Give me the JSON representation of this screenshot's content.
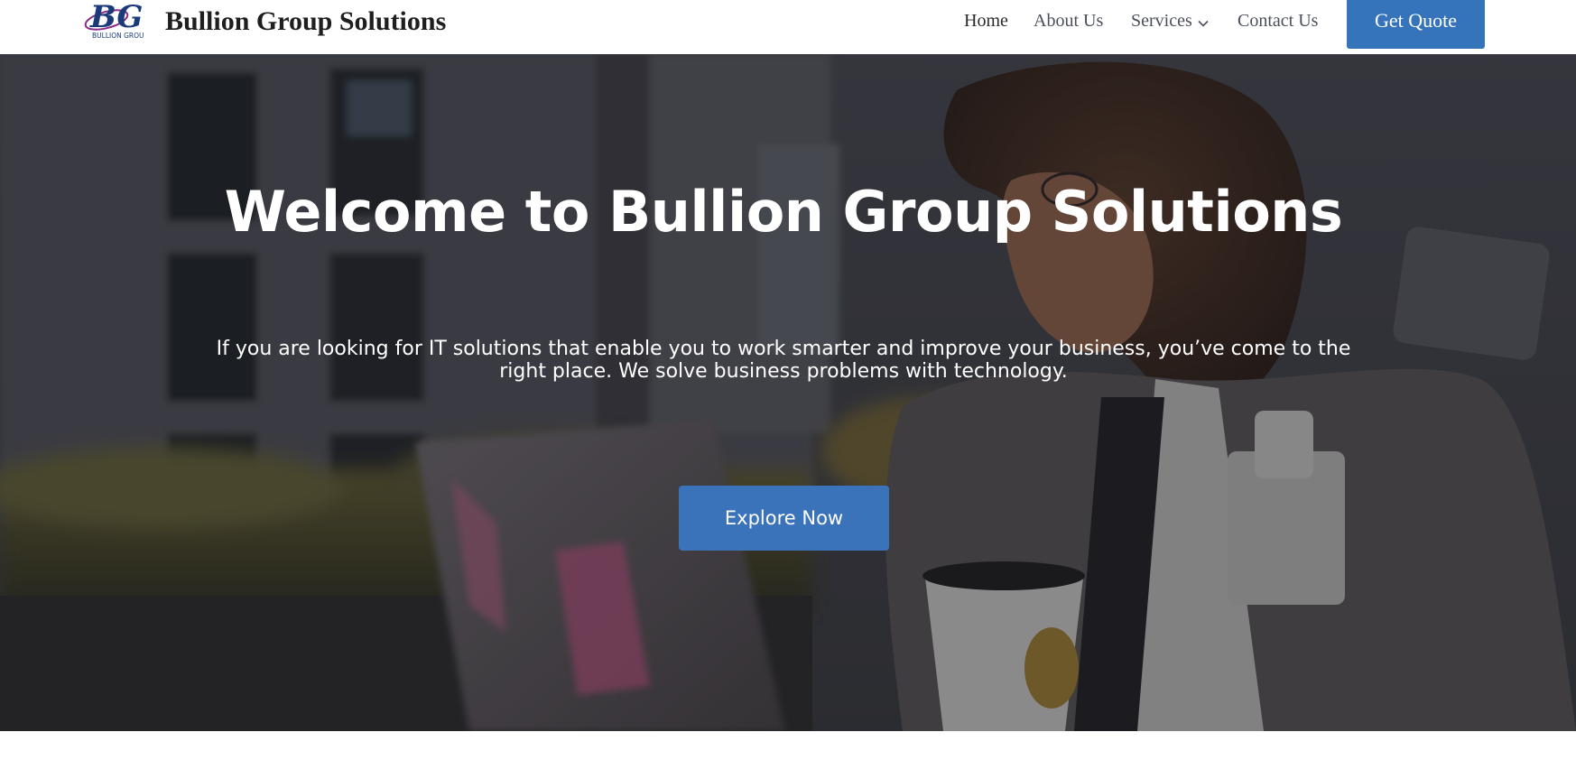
{
  "header": {
    "logo_text": "BG",
    "logo_caption": "BULLION GROUP",
    "brand_name": "Bullion Group Solutions",
    "nav": {
      "home": "Home",
      "about": "About Us",
      "services": "Services",
      "contact": "Contact Us"
    },
    "cta_label": "Get Quote"
  },
  "hero": {
    "title": "Welcome to Bullion Group Solutions",
    "subtitle": "If you are looking for IT solutions that enable you to work smarter and improve your business, you’ve come to the right place. We solve business problems with technology.",
    "button_label": "Explore Now"
  },
  "colors": {
    "accent": "#3573bb",
    "header_bg": "#ffffff",
    "hero_overlay": "#1a1a1f"
  },
  "icons": [
    "bullion-group-logo",
    "chevron-down-icon"
  ]
}
